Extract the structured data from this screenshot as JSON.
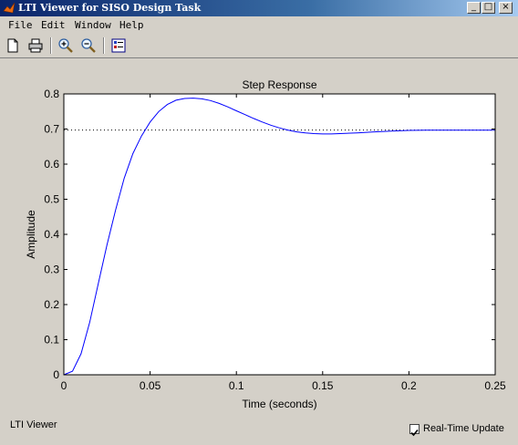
{
  "window": {
    "title": "LTI Viewer for SISO Design Task",
    "minimize_glyph": "_",
    "maximize_glyph": "□",
    "close_glyph": "×"
  },
  "menu": [
    "File",
    "Edit",
    "Window",
    "Help"
  ],
  "toolbar": {
    "icons": [
      "new-figure-icon",
      "print-icon",
      "zoom-in-icon",
      "zoom-out-icon",
      "plot-configurations-icon"
    ]
  },
  "chart_data": {
    "type": "line",
    "title": "Step Response",
    "xlabel": "Time (seconds)",
    "ylabel": "Amplitude",
    "xlim": [
      0,
      0.25
    ],
    "ylim": [
      0,
      0.8
    ],
    "x_ticks": [
      "0",
      "0.05",
      "0.1",
      "0.15",
      "0.2",
      "0.25"
    ],
    "y_ticks": [
      "0",
      "0.1",
      "0.2",
      "0.3",
      "0.4",
      "0.5",
      "0.6",
      "0.7",
      "0.8"
    ],
    "x_tick_values": [
      0,
      0.05,
      0.1,
      0.15,
      0.2,
      0.25
    ],
    "y_tick_values": [
      0,
      0.1,
      0.2,
      0.3,
      0.4,
      0.5,
      0.6,
      0.7,
      0.8
    ],
    "grid": false,
    "steady_state": 0.697,
    "series": [
      {
        "color": "#0000ff",
        "x": [
          0,
          0.005,
          0.01,
          0.015,
          0.02,
          0.025,
          0.03,
          0.035,
          0.04,
          0.045,
          0.05,
          0.055,
          0.06,
          0.065,
          0.07,
          0.075,
          0.08,
          0.085,
          0.09,
          0.095,
          0.1,
          0.105,
          0.11,
          0.115,
          0.12,
          0.125,
          0.13,
          0.135,
          0.14,
          0.145,
          0.15,
          0.155,
          0.16,
          0.17,
          0.18,
          0.19,
          0.2,
          0.21,
          0.22,
          0.23,
          0.24,
          0.25
        ],
        "y": [
          0,
          0.01,
          0.06,
          0.15,
          0.26,
          0.37,
          0.47,
          0.56,
          0.63,
          0.68,
          0.72,
          0.75,
          0.77,
          0.782,
          0.787,
          0.788,
          0.786,
          0.781,
          0.773,
          0.763,
          0.752,
          0.741,
          0.73,
          0.72,
          0.711,
          0.703,
          0.697,
          0.692,
          0.689,
          0.687,
          0.686,
          0.686,
          0.687,
          0.689,
          0.692,
          0.694,
          0.696,
          0.697,
          0.697,
          0.697,
          0.697,
          0.697
        ]
      }
    ]
  },
  "status": {
    "text": "LTI Viewer",
    "realtime_label": "Real-Time Update",
    "realtime_checked": true
  }
}
